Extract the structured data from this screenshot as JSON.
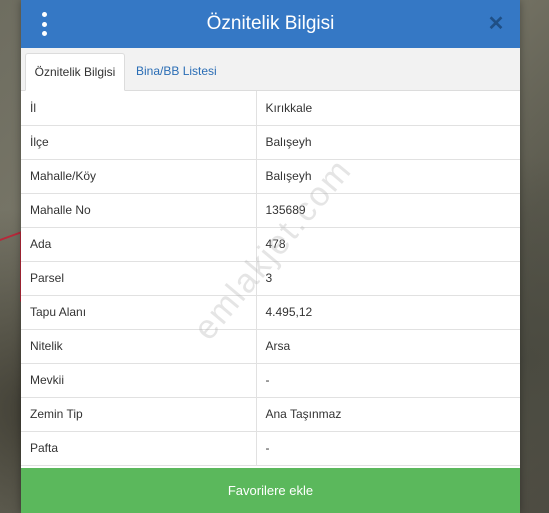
{
  "modal": {
    "title": "Öznitelik Bilgisi",
    "close_symbol": "✕"
  },
  "tabs": [
    {
      "label": "Öznitelik Bilgisi",
      "active": true
    },
    {
      "label": "Bina/BB Listesi",
      "active": false
    }
  ],
  "attributes": [
    {
      "key": "İl",
      "value": "Kırıkkale"
    },
    {
      "key": "İlçe",
      "value": "Balışeyh"
    },
    {
      "key": "Mahalle/Köy",
      "value": "Balışeyh"
    },
    {
      "key": "Mahalle No",
      "value": "135689"
    },
    {
      "key": "Ada",
      "value": "478"
    },
    {
      "key": "Parsel",
      "value": "3"
    },
    {
      "key": "Tapu Alanı",
      "value": "4.495,12"
    },
    {
      "key": "Nitelik",
      "value": "Arsa"
    },
    {
      "key": "Mevkii",
      "value": "-"
    },
    {
      "key": "Zemin Tip",
      "value": "Ana Taşınmaz"
    },
    {
      "key": "Pafta",
      "value": "-"
    }
  ],
  "footer": {
    "button_label": "Favorilere ekle"
  },
  "watermark": "emlakjet.com",
  "colors": {
    "header": "#3578c5",
    "tab_link": "#2a6db5",
    "button": "#5bb85c"
  },
  "icons": {
    "menu": "vertical-dots-menu-icon",
    "close": "close-icon"
  }
}
